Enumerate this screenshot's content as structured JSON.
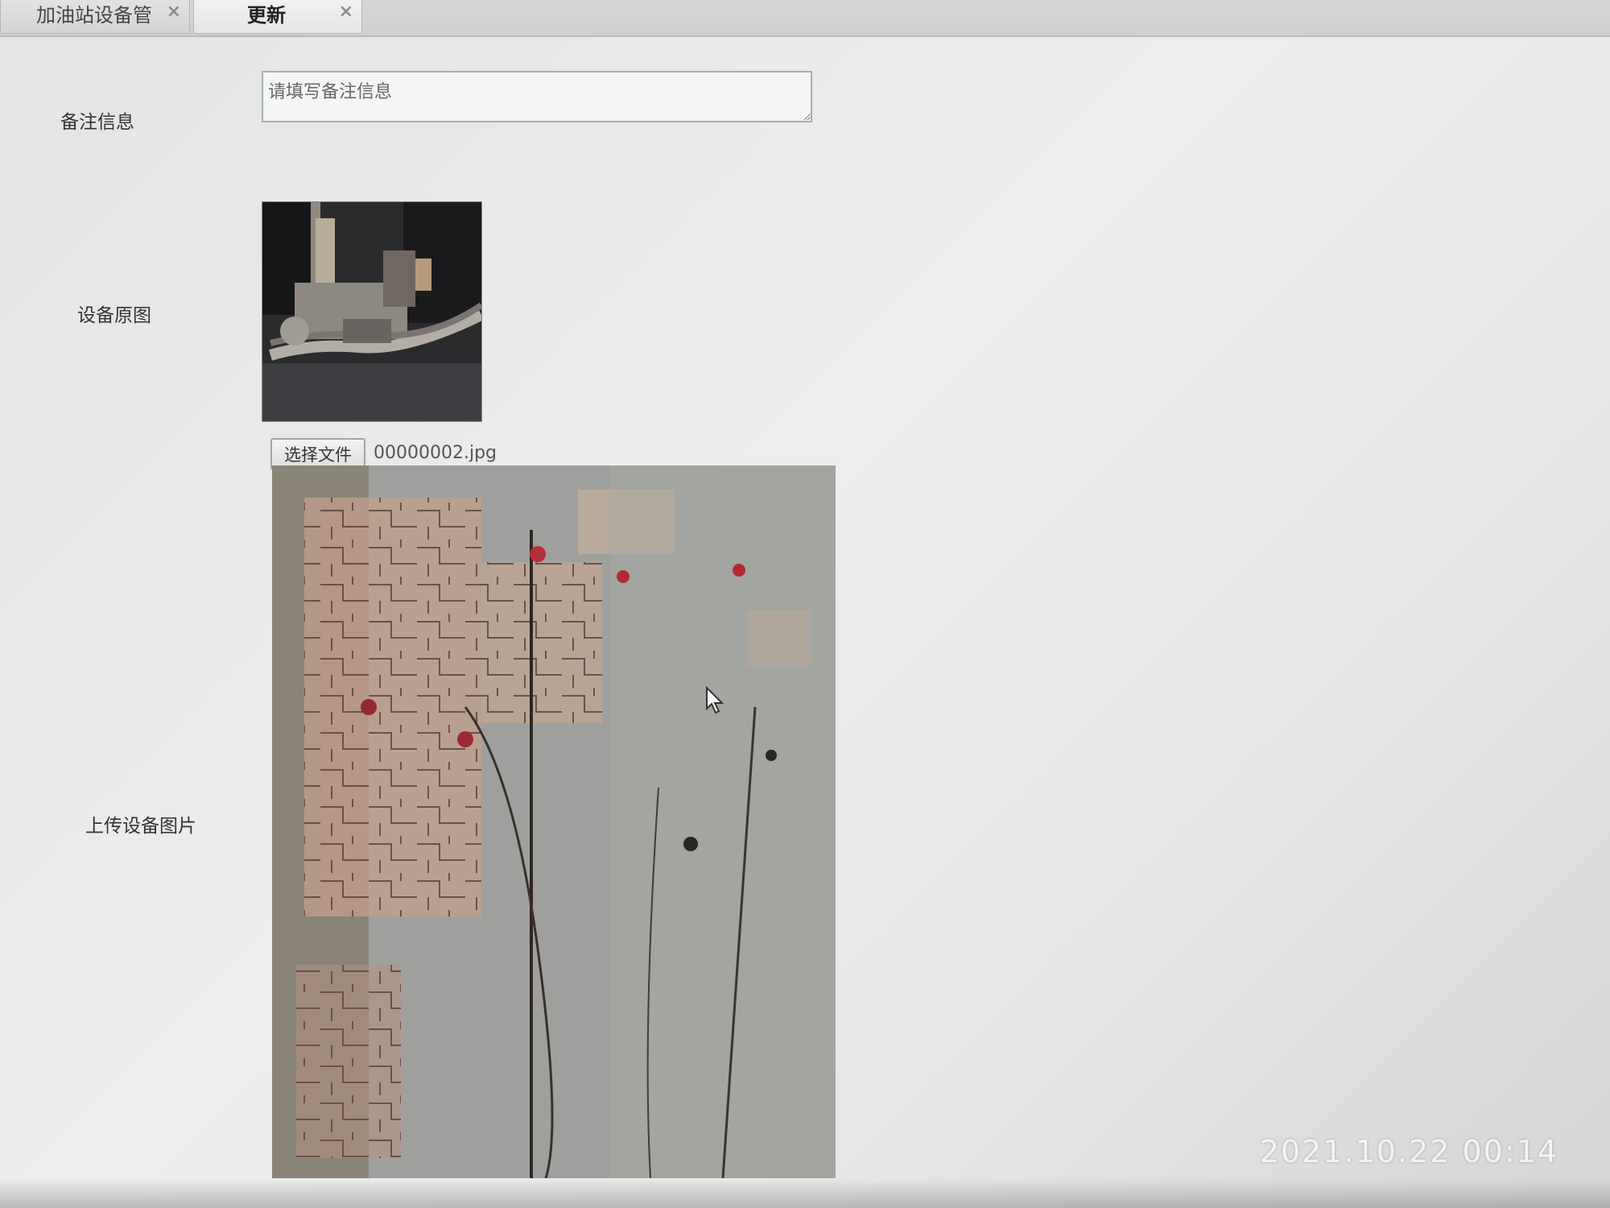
{
  "tabs": [
    {
      "label": "加油站设备管",
      "close": "×",
      "active": false
    },
    {
      "label": "更新",
      "close": "×",
      "active": true
    }
  ],
  "form": {
    "note_label": "备注信息",
    "note_placeholder": "请填写备注信息",
    "original_image_label": "设备原图",
    "upload_label": "上传设备图片",
    "choose_file_label": "选择文件",
    "file_name": "00000002.jpg"
  },
  "icons": {
    "cursor": "mouse-pointer-icon"
  },
  "timestamp": "2021.10.22 00:14"
}
